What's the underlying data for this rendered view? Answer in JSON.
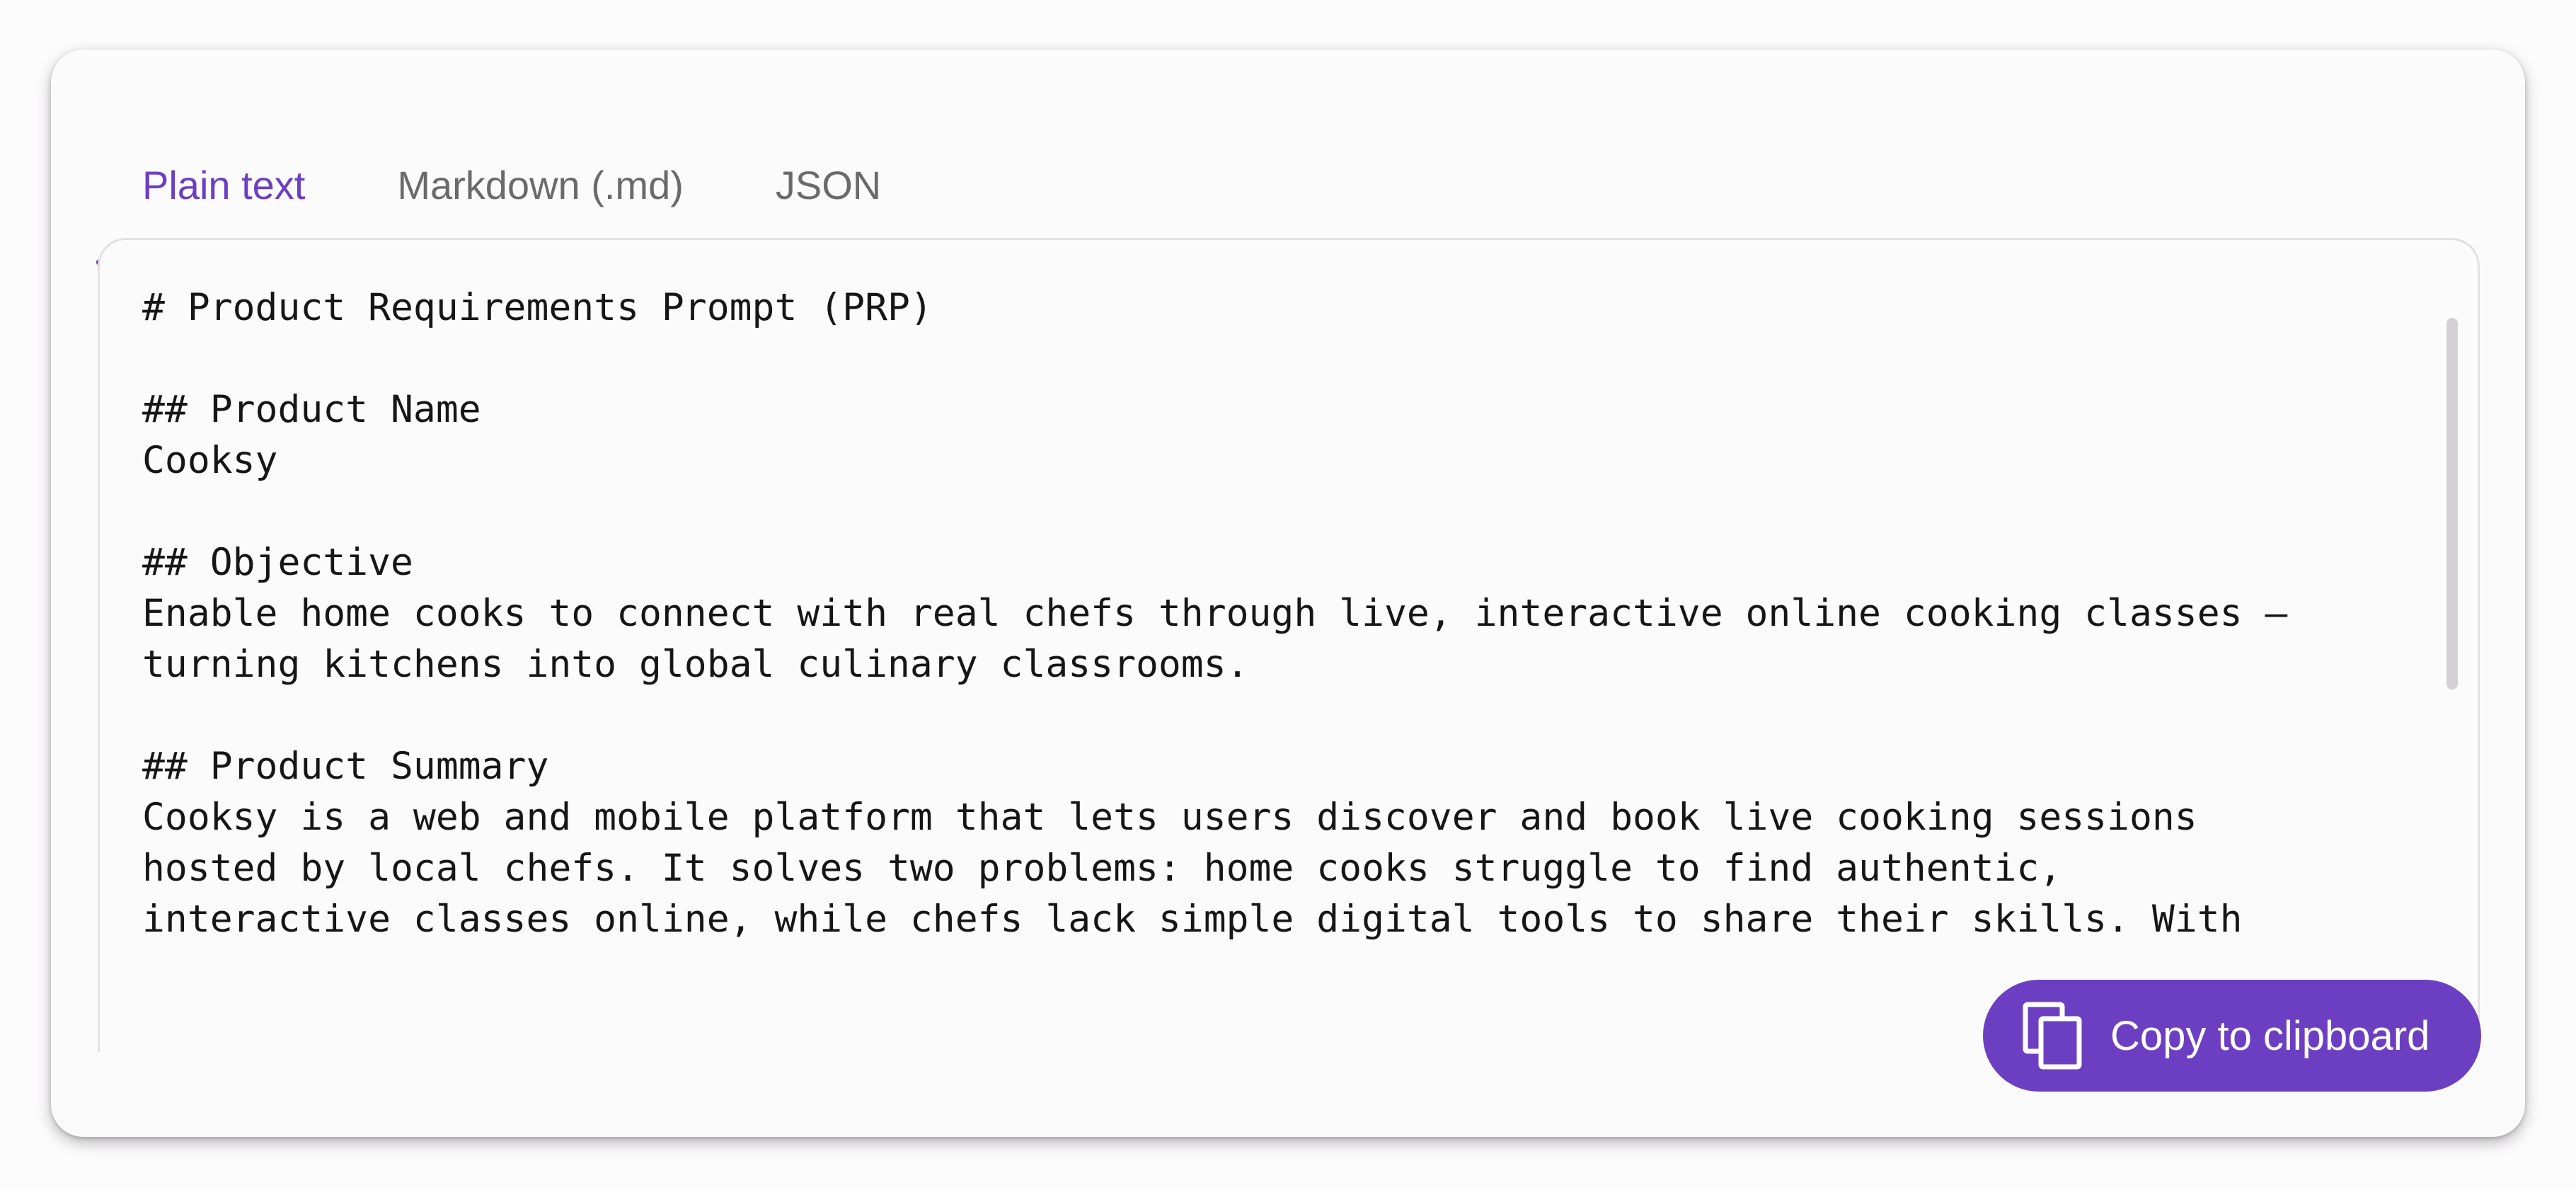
{
  "tabs": [
    {
      "label": "Plain text",
      "active": true
    },
    {
      "label": "Markdown (.md)",
      "active": false
    },
    {
      "label": "JSON",
      "active": false
    }
  ],
  "editor": {
    "content": "# Product Requirements Prompt (PRP)\n\n## Product Name\nCooksy\n\n## Objective\nEnable home cooks to connect with real chefs through live, interactive online cooking classes —\nturning kitchens into global culinary classrooms.\n\n## Product Summary\nCooksy is a web and mobile platform that lets users discover and book live cooking sessions\nhosted by local chefs. It solves two problems: home cooks struggle to find authentic,\ninteractive classes online, while chefs lack simple digital tools to share their skills. With"
  },
  "copy_button": {
    "label": "Copy to clipboard",
    "icon": "copy-icon"
  },
  "colors": {
    "accent": "#6c3fc2",
    "tab_inactive": "#6a6a6a",
    "text": "#161616"
  }
}
